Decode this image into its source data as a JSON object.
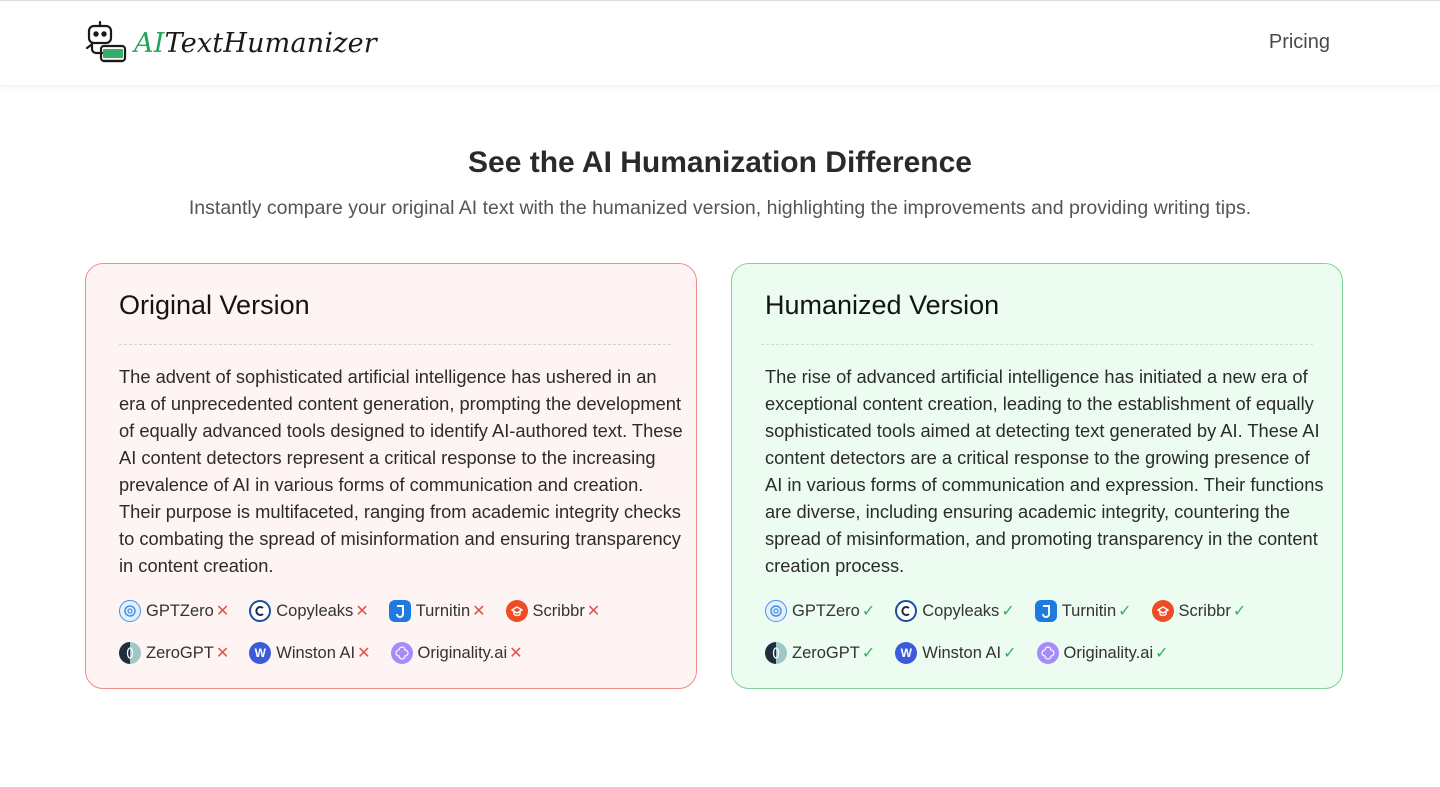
{
  "header": {
    "logo": {
      "prefix": "AI",
      "suffix": "TextHumanizer"
    },
    "nav": {
      "pricing": "Pricing"
    }
  },
  "hero": {
    "title": "See the AI Humanization Difference",
    "subtitle": "Instantly compare your original AI text with the humanized version, highlighting the improvements and providing writing tips."
  },
  "colors": {
    "accent_green": "#22a45a",
    "fail_red": "#e5534b",
    "pass_green": "#2fb35f",
    "original_border": "#ef8f8a",
    "humanized_border": "#7fd29a"
  },
  "original": {
    "title": "Original Version",
    "text": "The advent of sophisticated artificial intelligence has ushered in an era of unprecedented content generation, prompting the development of equally advanced tools designed to identify AI-authored text. These AI content detectors represent a critical response to the increasing prevalence of AI in various forms of communication and creation. Their purpose is multifaceted, ranging from academic integrity checks to combating the spread of misinformation and ensuring transparency in content creation.",
    "result_mark": "✕",
    "detectors": [
      {
        "name": "GPTZero",
        "icon": "gptzero-icon"
      },
      {
        "name": "Copyleaks",
        "icon": "copyleaks-icon"
      },
      {
        "name": "Turnitin",
        "icon": "turnitin-icon"
      },
      {
        "name": "Scribbr",
        "icon": "scribbr-icon"
      },
      {
        "name": "ZeroGPT",
        "icon": "zerogpt-icon"
      },
      {
        "name": "Winston AI",
        "icon": "winston-icon"
      },
      {
        "name": "Originality.ai",
        "icon": "originality-icon"
      }
    ]
  },
  "humanized": {
    "title": "Humanized Version",
    "text": "The rise of advanced artificial intelligence has initiated a new era of exceptional content creation, leading to the establishment of equally sophisticated tools aimed at detecting text generated by AI. These AI content detectors are a critical response to the growing presence of AI in various forms of communication and expression. Their functions are diverse, including ensuring academic integrity, countering the spread of misinformation, and promoting transparency in the content creation process.",
    "result_mark": "✓",
    "detectors": [
      {
        "name": "GPTZero",
        "icon": "gptzero-icon"
      },
      {
        "name": "Copyleaks",
        "icon": "copyleaks-icon"
      },
      {
        "name": "Turnitin",
        "icon": "turnitin-icon"
      },
      {
        "name": "Scribbr",
        "icon": "scribbr-icon"
      },
      {
        "name": "ZeroGPT",
        "icon": "zerogpt-icon"
      },
      {
        "name": "Winston AI",
        "icon": "winston-icon"
      },
      {
        "name": "Originality.ai",
        "icon": "originality-icon"
      }
    ]
  }
}
